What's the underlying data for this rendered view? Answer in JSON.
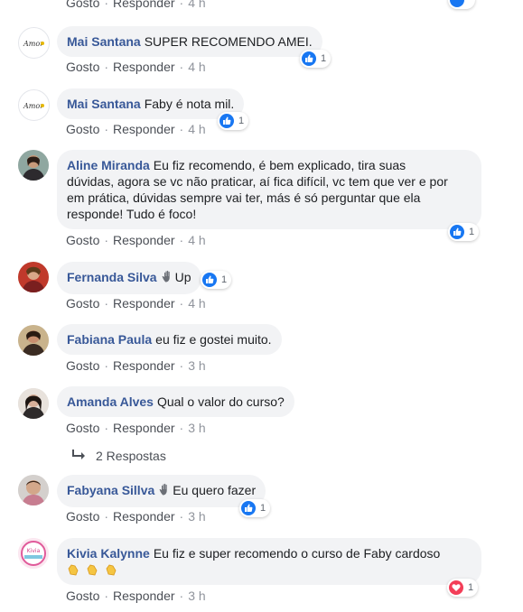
{
  "labels": {
    "like": "Gosto",
    "reply": "Responder",
    "dot": "·"
  },
  "top_partial": {
    "time": "4 h"
  },
  "comments": [
    {
      "author": "Mai Santana",
      "text": "SUPER RECOMENDO AMEI.",
      "time": "4 h",
      "reactions": "1",
      "reaction_type": "like-icon",
      "avatar": "logo Amor"
    },
    {
      "author": "Mai Santana",
      "text": "Faby é nota mil.",
      "time": "4 h",
      "reactions": "1",
      "reaction_type": "like-icon",
      "avatar": "logo Amor"
    },
    {
      "author": "Aline Miranda",
      "text": "Eu fiz recomendo, é bem explicado, tira suas",
      "text2": "dúvidas, agora se vc não praticar, aí fica difícil, vc tem que ver e por",
      "text3": "em prática, dúvidas sempre vai ter, más é só perguntar que ela",
      "text4": "responde! Tudo é foco!",
      "time": "4 h",
      "reactions": "1",
      "reaction_type": "like-icon"
    },
    {
      "author": "Fernanda Silva",
      "text": "Up",
      "time": "4 h",
      "reactions": "1",
      "reaction_type": "like-icon",
      "emoji": "waving-hand-icon"
    },
    {
      "author": "Fabiana Paula",
      "text": "eu fiz e gostei muito.",
      "time": "3 h"
    },
    {
      "author": "Amanda Alves",
      "text": "Qual o valor do curso?",
      "time": "3 h"
    },
    {
      "author": "Fabyana Sillva",
      "text": "Eu quero fazer",
      "time": "3 h",
      "reactions": "1",
      "reaction_type": "like-icon",
      "emoji": "waving-hand-icon"
    },
    {
      "author": "Kivia Kalynne",
      "text": "Eu fiz e super recomendo o curso de Faby cardoso",
      "time": "3 h",
      "reactions": "1",
      "reaction_type": "heart-icon",
      "emoji": "clapping-hands-icon"
    }
  ],
  "replies_link": {
    "label": "2 Respostas"
  },
  "colors": {
    "author": "#385898",
    "like_blue": "#1877f2",
    "love_red": "#f33e58",
    "bubble_bg": "#f2f3f5"
  }
}
